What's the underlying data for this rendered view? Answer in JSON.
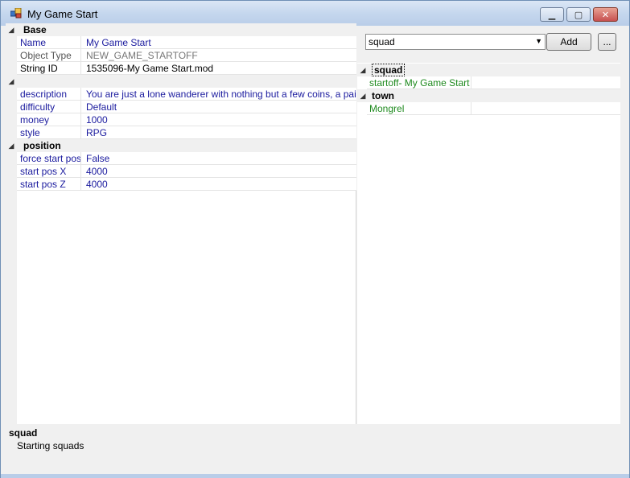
{
  "window": {
    "title": "My Game Start",
    "min_icon": "window-minimize",
    "max_icon": "window-maximize",
    "close_icon": "window-close"
  },
  "property_grid": {
    "categories": [
      {
        "label": "Base",
        "rows": [
          {
            "name": "Name",
            "value": "My Game Start"
          },
          {
            "name": "Object Type",
            "value": "NEW_GAME_STARTOFF"
          },
          {
            "name": "String ID",
            "value": "1535096-My Game Start.mod"
          }
        ]
      },
      {
        "label": "",
        "rows": [
          {
            "name": "description",
            "value": "You are just a lone wanderer with nothing but a few coins, a pair of par"
          },
          {
            "name": "difficulty",
            "value": "Default"
          },
          {
            "name": "money",
            "value": "1000"
          },
          {
            "name": "style",
            "value": "RPG"
          }
        ]
      },
      {
        "label": "position",
        "rows": [
          {
            "name": "force start pos",
            "value": "False"
          },
          {
            "name": "start pos X",
            "value": "4000"
          },
          {
            "name": "start pos Z",
            "value": "4000"
          }
        ]
      }
    ]
  },
  "reference_panel": {
    "selected_type": "squad",
    "add_label": "Add",
    "more_label": "...",
    "groups": [
      {
        "label": "squad",
        "items": [
          "startoff- My Game Start"
        ]
      },
      {
        "label": "town",
        "items": [
          "Mongrel"
        ]
      }
    ]
  },
  "help": {
    "title": "squad",
    "description": "Starting squads"
  }
}
